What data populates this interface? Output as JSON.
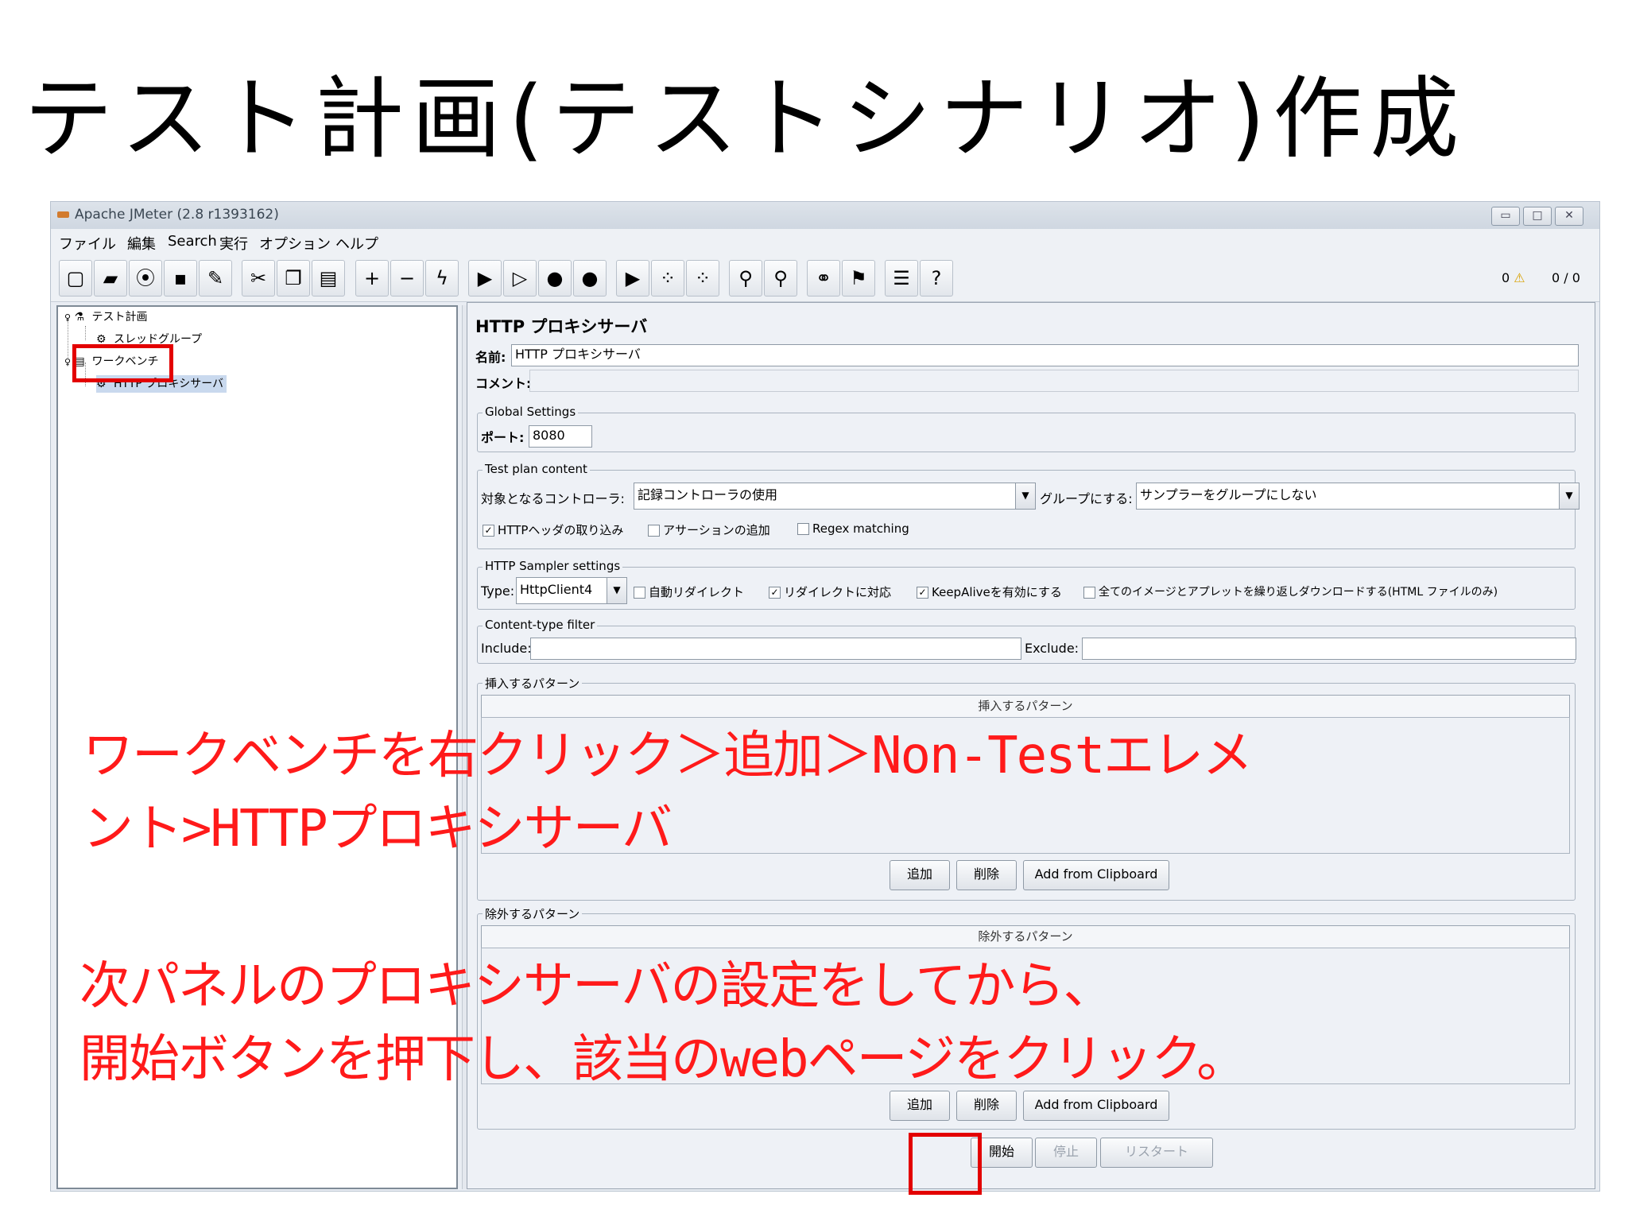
{
  "slide": {
    "title": "テスト計画(テストシナリオ)作成"
  },
  "window": {
    "title": "Apache JMeter (2.8 r1393162)",
    "controls": [
      "minimize-icon",
      "maximize-icon",
      "close-icon"
    ]
  },
  "menu": [
    "ファイル",
    "編集",
    "Search",
    "実行",
    "オプション",
    "ヘルプ"
  ],
  "toolbar": {
    "buttons": [
      "new-icon",
      "open-icon",
      "close-plan-icon",
      "save-icon",
      "save-as-icon",
      "cut-icon",
      "copy-icon",
      "paste-icon",
      "expand-icon",
      "collapse-icon",
      "toggle-icon",
      "start-icon",
      "start-no-pause-icon",
      "stop-icon",
      "shutdown-icon",
      "remote-start-icon",
      "remote-stop-icon",
      "remote-shutdown-icon",
      "clear-icon",
      "clear-all-icon",
      "search-icon",
      "reset-search-icon",
      "function-helper-icon",
      "help-icon"
    ],
    "warnings": "0",
    "threads": "0 / 0"
  },
  "tree": {
    "items": [
      {
        "label": "テスト計画",
        "icon": "test-plan-icon"
      },
      {
        "label": "スレッドグループ",
        "icon": "thread-group-icon"
      },
      {
        "label": "ワークベンチ",
        "icon": "workbench-icon"
      },
      {
        "label": "HTTP プロキシサーバ",
        "icon": "proxy-icon"
      }
    ]
  },
  "panel": {
    "heading": "HTTP プロキシサーバ",
    "name_label": "名前:",
    "name_value": "HTTP プロキシサーバ",
    "comment_label": "コメント:",
    "global_settings": {
      "title": "Global Settings",
      "port_label": "ポート:",
      "port_value": "8080"
    },
    "test_plan_content": {
      "title": "Test plan content",
      "controller_label": "対象となるコントローラ:",
      "controller_value": "記録コントローラの使用",
      "group_label": "グループにする:",
      "group_value": "サンプラーをグループにしない",
      "checkboxes": [
        {
          "label": "HTTPヘッダの取り込み",
          "checked": true
        },
        {
          "label": "アサーションの追加",
          "checked": false
        },
        {
          "label": "Regex matching",
          "checked": false
        }
      ]
    },
    "sampler_settings": {
      "title": "HTTP Sampler settings",
      "type_label": "Type:",
      "type_value": "HttpClient4",
      "checkboxes": [
        {
          "label": "自動リダイレクト",
          "checked": false
        },
        {
          "label": "リダイレクトに対応",
          "checked": true
        },
        {
          "label": "KeepAliveを有効にする",
          "checked": true
        },
        {
          "label": "全てのイメージとアプレットを繰り返しダウンロードする(HTML ファイルのみ)",
          "checked": false
        }
      ]
    },
    "content_filter": {
      "title": "Content-type filter",
      "include_label": "Include:",
      "exclude_label": "Exclude:"
    },
    "include_patterns": {
      "title": "挿入するパターン",
      "column": "挿入するパターン"
    },
    "exclude_patterns": {
      "title": "除外するパターン",
      "column": "除外するパターン"
    },
    "pattern_buttons": {
      "add": "追加",
      "delete": "削除",
      "clipboard": "Add from Clipboard"
    },
    "bottom_buttons": {
      "start": "開始",
      "stop": "停止",
      "restart": "リスタート"
    }
  },
  "annotations": {
    "note1_line1": "ワークベンチを右クリック＞追加＞Non-Testエレメ",
    "note1_line2": "ント>HTTPプロキシサーバ",
    "note2_line1": "次パネルのプロキシサーバの設定をしてから、",
    "note2_line2": "開始ボタンを押下し、該当のwebページをクリック。"
  },
  "colors": {
    "annotation": "#ff1a1a",
    "highlight_box": "#e30000"
  }
}
